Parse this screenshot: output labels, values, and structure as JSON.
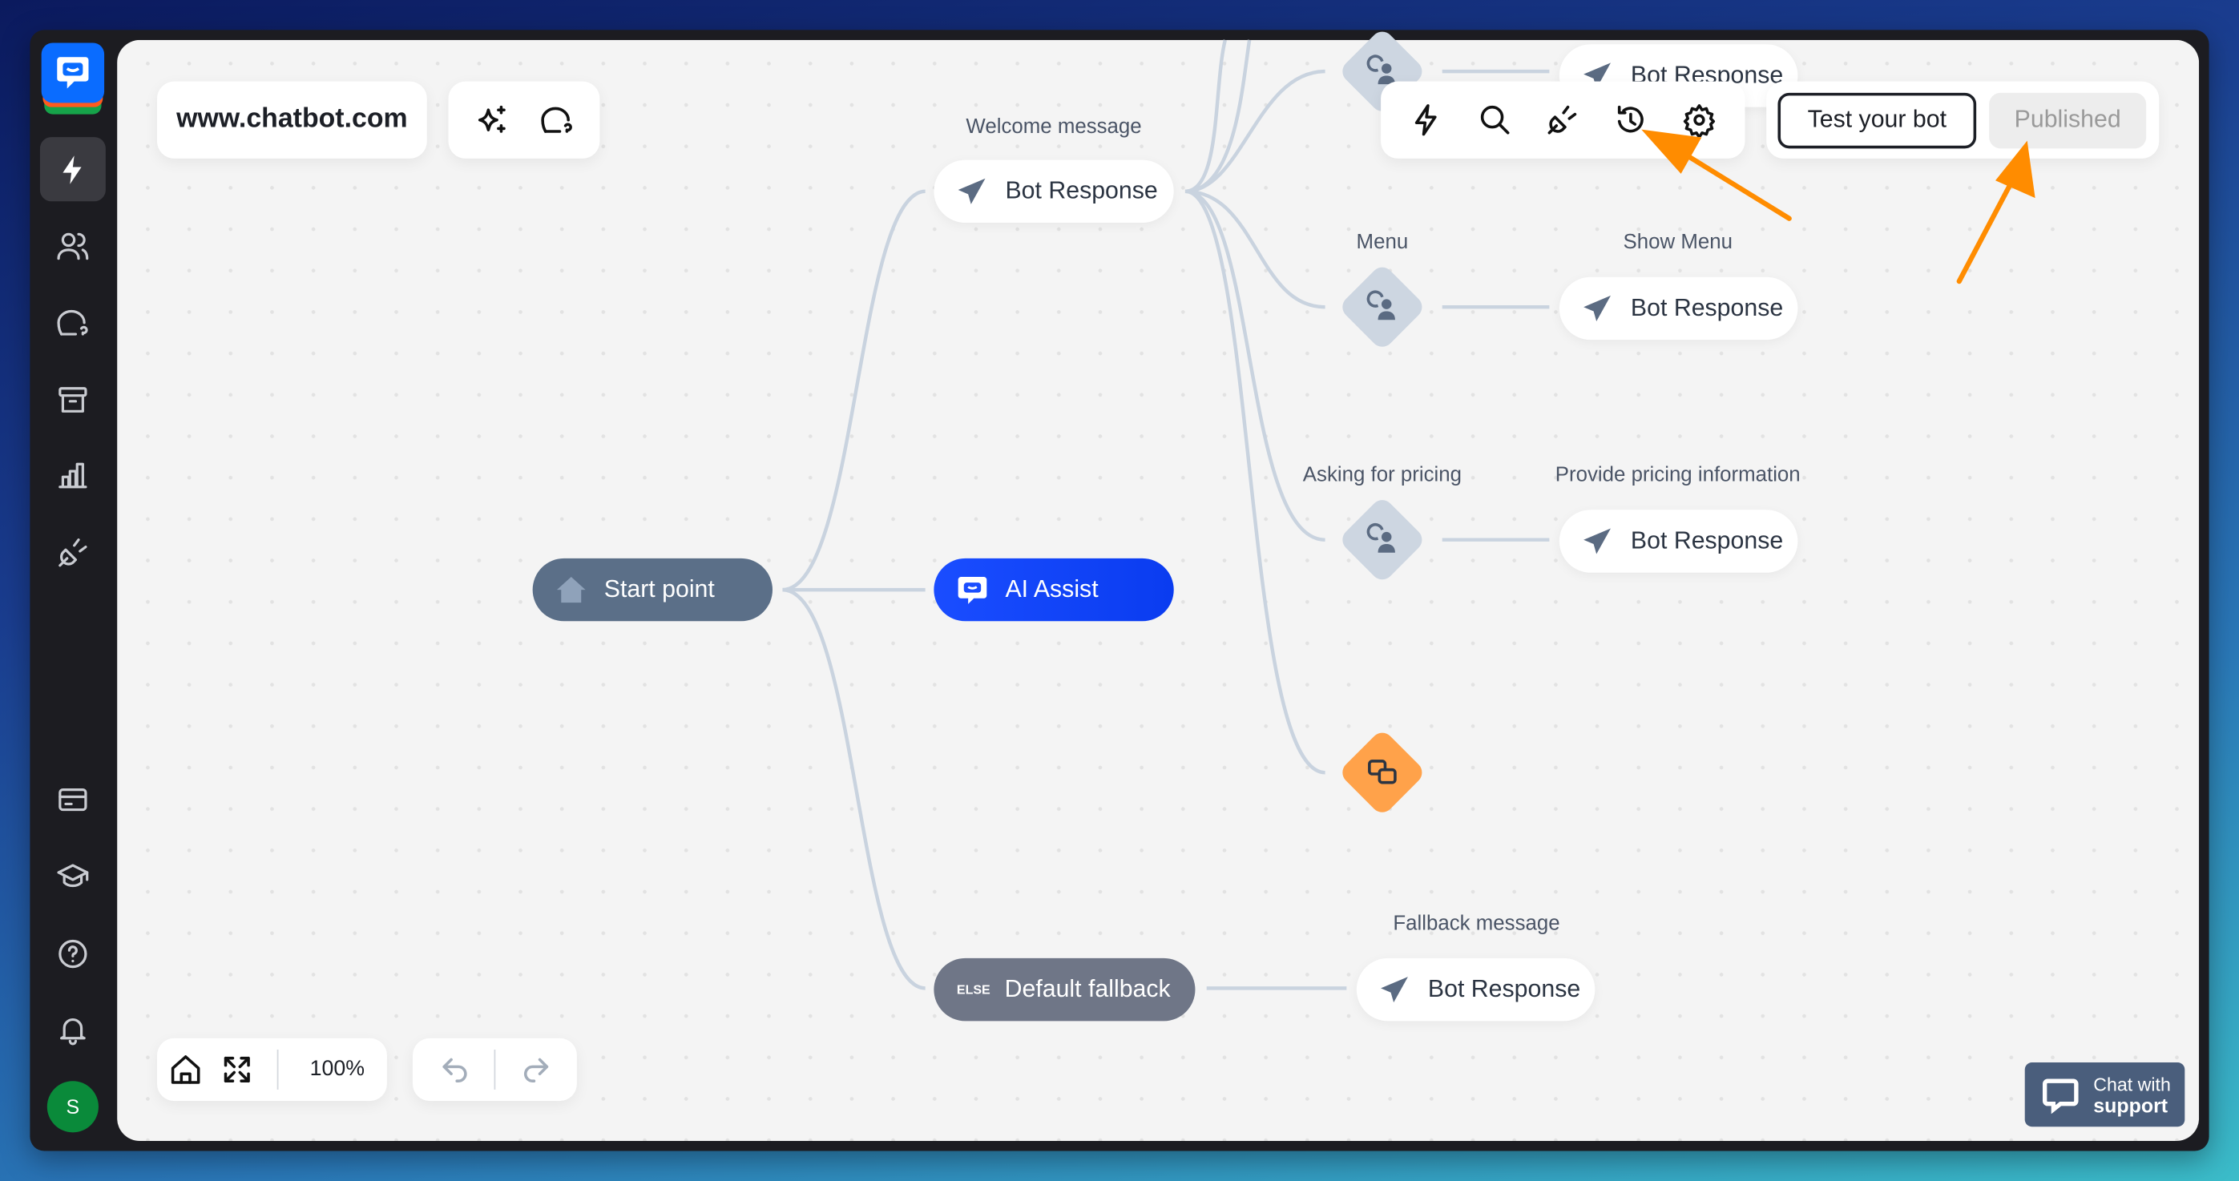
{
  "header": {
    "site": "www.chatbot.com"
  },
  "toolbar": {
    "test_label": "Test your bot",
    "published_label": "Published"
  },
  "sidebar": {
    "avatar_initial": "S"
  },
  "flow": {
    "start": "Start point",
    "ai_assist": "AI Assist",
    "welcome_label": "Welcome message",
    "welcome_node": "Bot Response",
    "top_node": "Bot Response",
    "menu_label": "Menu",
    "show_menu_label": "Show Menu",
    "show_menu_node": "Bot Response",
    "pricing_label": "Asking for pricing",
    "pricing_info_label": "Provide pricing information",
    "pricing_node": "Bot Response",
    "fallback": "Default fallback",
    "fallback_tag": "ELSE",
    "fallback_label": "Fallback message",
    "fallback_node": "Bot Response"
  },
  "zoom": {
    "level": "100%"
  },
  "support": {
    "line1": "Chat with",
    "line2": "support"
  },
  "colors": {
    "accent": "#0a4dff",
    "annotation_arrow": "#ff8c00",
    "start_node": "#5b6f88",
    "fallback_node": "#6f7687",
    "avatar": "#0a8a3a",
    "diamond_orange": "#ffa24a"
  }
}
